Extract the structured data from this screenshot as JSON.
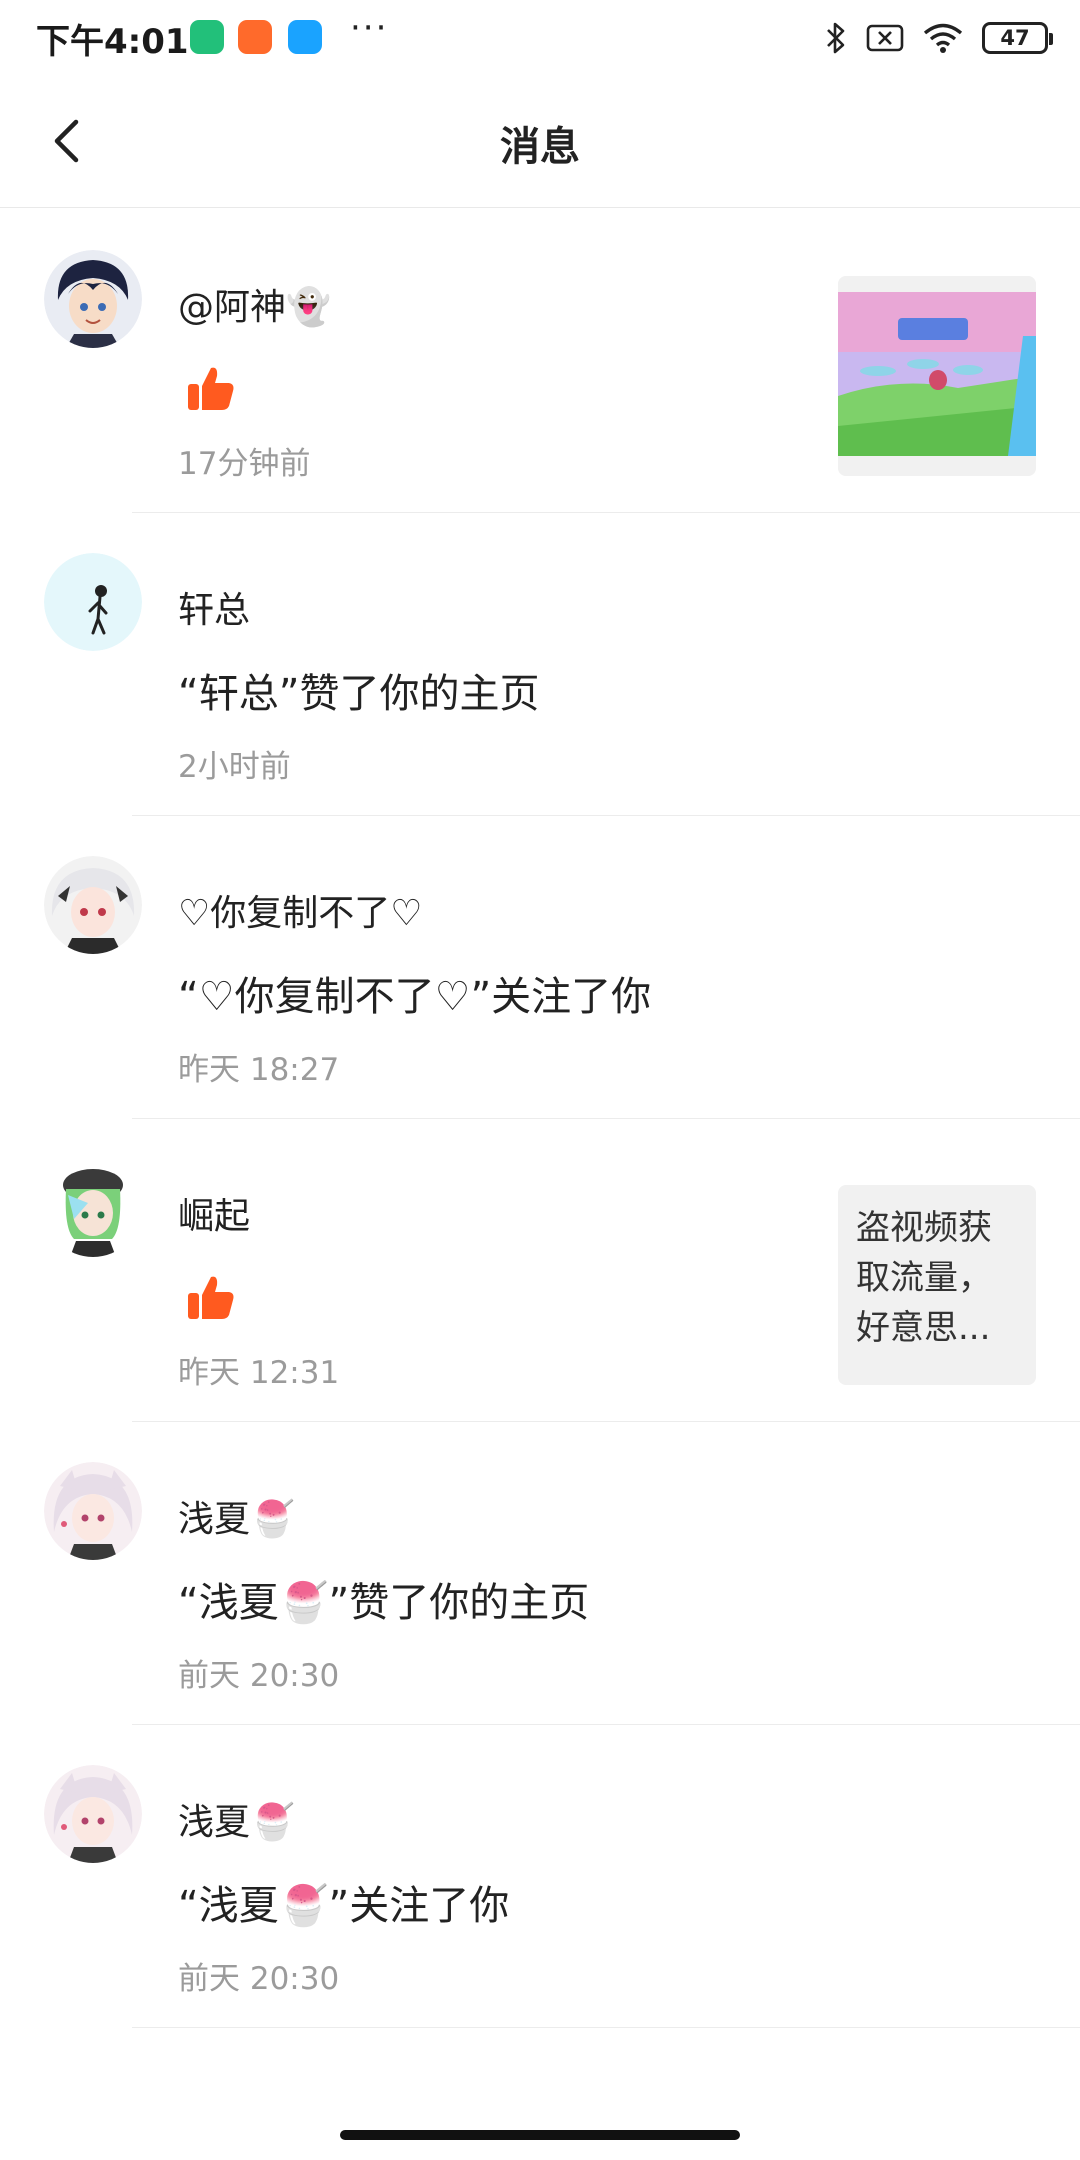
{
  "status_bar": {
    "time": "下午4:01",
    "dots": "···",
    "battery": "47"
  },
  "header": {
    "title": "消息"
  },
  "messages": [
    {
      "name": "@阿神👻",
      "text": "",
      "time": "17分钟前",
      "type": "like"
    },
    {
      "name": "轩总",
      "text": "“轩总”赞了你的主页",
      "time": "2小时前",
      "type": "text"
    },
    {
      "name": "♡你复制不了♡",
      "text": "“♡你复制不了♡”关注了你",
      "time": "昨天 18:27",
      "type": "text"
    },
    {
      "name": "崛起",
      "text": "",
      "time": "昨天 12:31",
      "type": "like",
      "preview": "盗视频获取流量，好意思..."
    },
    {
      "name": "浅夏🍧",
      "text": "“浅夏🍧”赞了你的主页",
      "time": "前天 20:30",
      "type": "text"
    },
    {
      "name": "浅夏🍧",
      "text": "“浅夏🍧”关注了你",
      "time": "前天 20:30",
      "type": "text"
    }
  ],
  "colors": {
    "like": "#ff5a1f",
    "time": "#9b9b9b"
  },
  "icons": {
    "back": "chevron-left-icon",
    "like": "thumbs-up-icon"
  }
}
